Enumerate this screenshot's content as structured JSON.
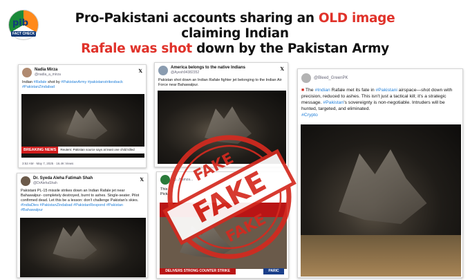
{
  "logo": {
    "text": "pib",
    "sub": "FACT CHECK"
  },
  "headline": {
    "part1": "Pro-Pakistani accounts sharing an ",
    "highlight1": "OLD image",
    "part2": " claiming  Indian",
    "highlight2": "Rafale was shot",
    "part3": " down by the Pakistan Army"
  },
  "tweets": [
    {
      "name": "Nadia Mirza",
      "handle": "@nadia_a_mirza",
      "text_pre": "Indian ",
      "text_tag1": "#Rafale",
      "text_mid1": " shot by ",
      "text_tag2": "#PakistanArmy #pakistanstrikesback",
      "text_tag3": "#PakistanZindabad",
      "breaking_label": "BREAKING NEWS",
      "breaking_text": "Reuters: Pakistan source says at least one child killed",
      "meta": "3:52 AM · May 7, 2025 · 16.4K Views"
    },
    {
      "name": "America belongs to the native Indians",
      "handle": "@Ayesh94382352",
      "text": "Pakistan shot down an Indian Rafale fighter jet belonging to the Indian Air Force near Bahawalpur."
    },
    {
      "name": "Dr. Syeda Aleha Fatimah Shah",
      "handle": "@DrAlehaShah",
      "text_body": "Pakistani PL-15 missile strikes down an Indian Rafale jet near Bahawalpur- completely destroyed, burnt to ashes. Single-seater. Pilot confirmed dead. Let this be a lesson: don't challenge Pakistan's skies.",
      "text_tags": "#IndiaDies #PakistanZindabad #PakistanRespond #Pakistan",
      "text_tags2": "#Bahawalpur"
    },
    {
      "name": "",
      "handle": "@...Hamza...",
      "text": "This ",
      "text2": "Pictu",
      "tv_banner": "DELIVERS STRONG COUNTER STRIKE",
      "tv_tag": "PARIC"
    },
    {
      "name": "@Bleed_GreenPK",
      "text_pre": "The ",
      "tag1": "#Indian",
      "text_a": " Rafale met its fate in ",
      "tag2": "#Pakistani",
      "text_b": " airspace—shot down with precision, reduced to ashes. This isn't just a tactical kill; it's a strategic message. ",
      "tag3": "#Pakistan",
      "text_c": "'s sovereignty is non-negotiable. Intruders will be hunted, targeted, and eliminated.",
      "tag4": "#Crypto"
    }
  ],
  "stamp": {
    "word": "FAKE",
    "color": "#d42a1f"
  }
}
